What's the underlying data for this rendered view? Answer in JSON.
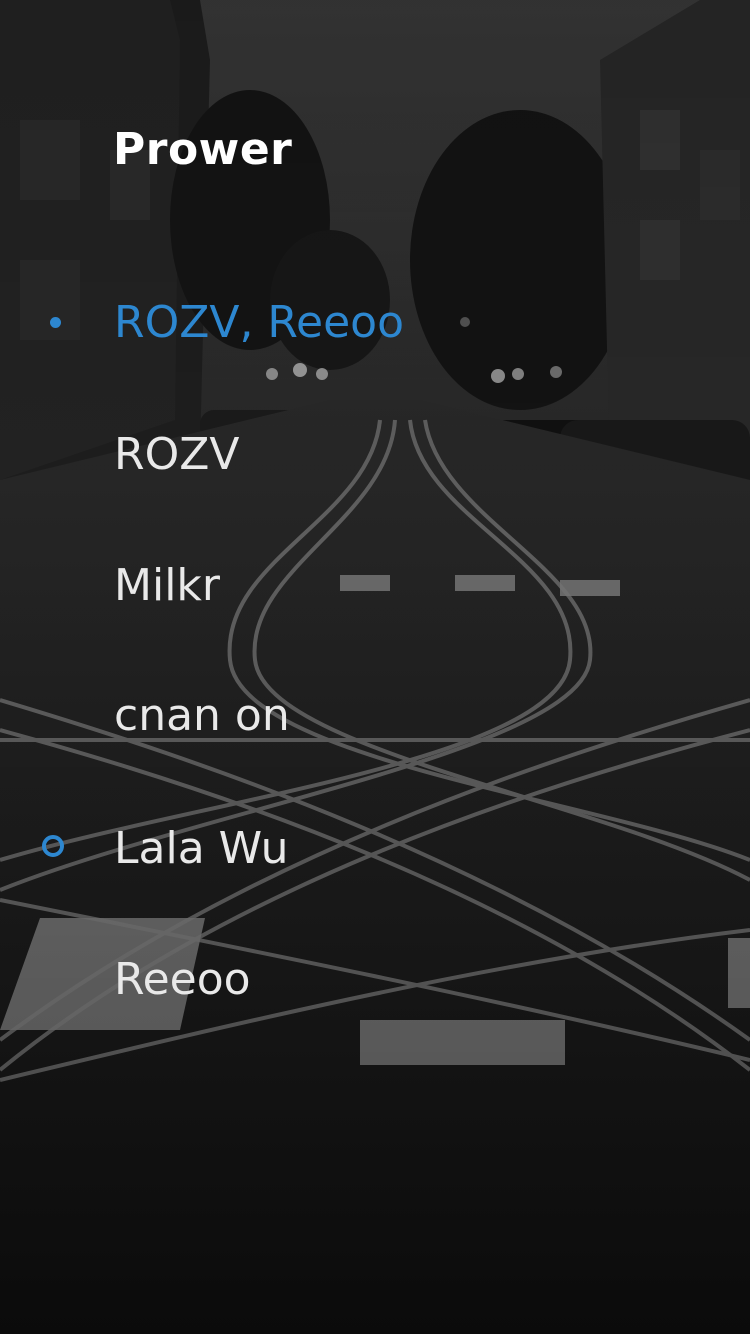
{
  "menu": {
    "title": "Prower",
    "items": [
      {
        "label": "ROZV, Reeoo",
        "state": "active"
      },
      {
        "label": "ROZV"
      },
      {
        "label": "Milkr"
      },
      {
        "label": "cnan on"
      },
      {
        "label": "Lala Wu",
        "marker": "ring"
      },
      {
        "label": "Reeoo"
      }
    ]
  },
  "colors": {
    "accent": "#2d87d0",
    "text": "#e9e9e9",
    "header": "#ffffff"
  },
  "icons": [
    "selected-dot-icon",
    "ring-icon"
  ]
}
